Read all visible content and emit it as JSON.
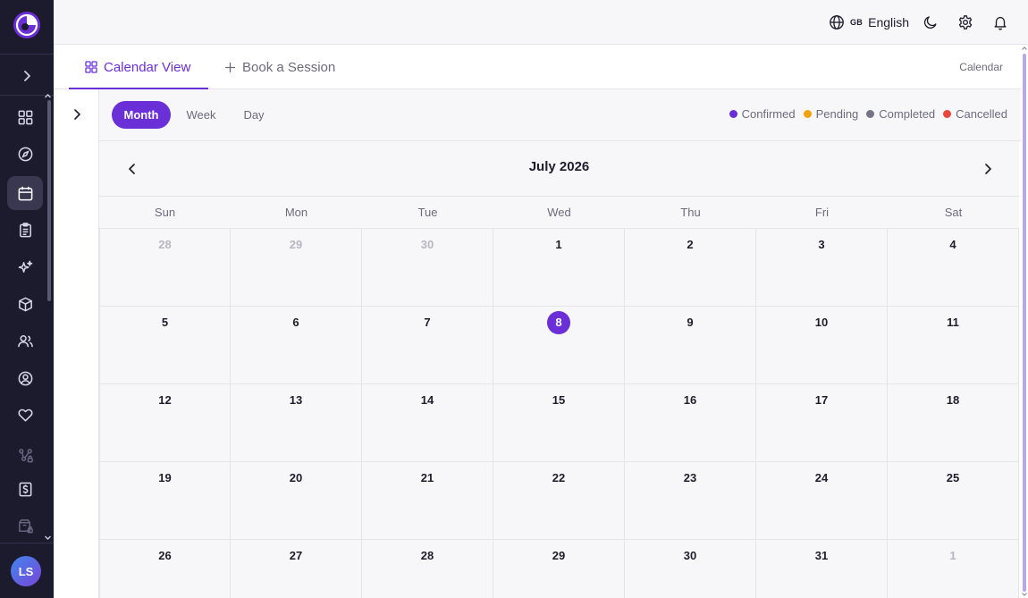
{
  "sidebar": {
    "icons": [
      "dashboard-icon",
      "compass-icon",
      "calendar-icon",
      "clipboard-icon",
      "sparkles-icon",
      "package-icon",
      "users-icon",
      "user-circle-icon",
      "heart-icon",
      "workflow-icon",
      "dollar-icon",
      "archive-icon"
    ],
    "active": "calendar-icon",
    "user_initials": "LS"
  },
  "topbar": {
    "language_flag": "GB",
    "language_label": "English"
  },
  "tabs": {
    "calendar_view": "Calendar View",
    "book_session": "Book a Session",
    "breadcrumb": "Calendar"
  },
  "toolbar": {
    "views": [
      "Month",
      "Week",
      "Day"
    ],
    "active_view": "Month",
    "legend": [
      {
        "label": "Confirmed",
        "color": "#6a2fd6"
      },
      {
        "label": "Pending",
        "color": "#f0a30a"
      },
      {
        "label": "Completed",
        "color": "#75758a"
      },
      {
        "label": "Cancelled",
        "color": "#e8473e"
      }
    ]
  },
  "calendar": {
    "month_title": "July 2026",
    "weekdays": [
      "Sun",
      "Mon",
      "Tue",
      "Wed",
      "Thu",
      "Fri",
      "Sat"
    ],
    "today": "8",
    "weeks": [
      [
        {
          "d": "28",
          "muted": true
        },
        {
          "d": "29",
          "muted": true
        },
        {
          "d": "30",
          "muted": true
        },
        {
          "d": "1"
        },
        {
          "d": "2"
        },
        {
          "d": "3"
        },
        {
          "d": "4"
        }
      ],
      [
        {
          "d": "5"
        },
        {
          "d": "6"
        },
        {
          "d": "7"
        },
        {
          "d": "8",
          "today": true
        },
        {
          "d": "9"
        },
        {
          "d": "10"
        },
        {
          "d": "11"
        }
      ],
      [
        {
          "d": "12"
        },
        {
          "d": "13"
        },
        {
          "d": "14"
        },
        {
          "d": "15"
        },
        {
          "d": "16"
        },
        {
          "d": "17"
        },
        {
          "d": "18"
        }
      ],
      [
        {
          "d": "19"
        },
        {
          "d": "20"
        },
        {
          "d": "21"
        },
        {
          "d": "22"
        },
        {
          "d": "23"
        },
        {
          "d": "24"
        },
        {
          "d": "25"
        }
      ],
      [
        {
          "d": "26"
        },
        {
          "d": "27"
        },
        {
          "d": "28"
        },
        {
          "d": "29"
        },
        {
          "d": "30"
        },
        {
          "d": "31"
        },
        {
          "d": "1",
          "muted": true
        }
      ]
    ]
  }
}
